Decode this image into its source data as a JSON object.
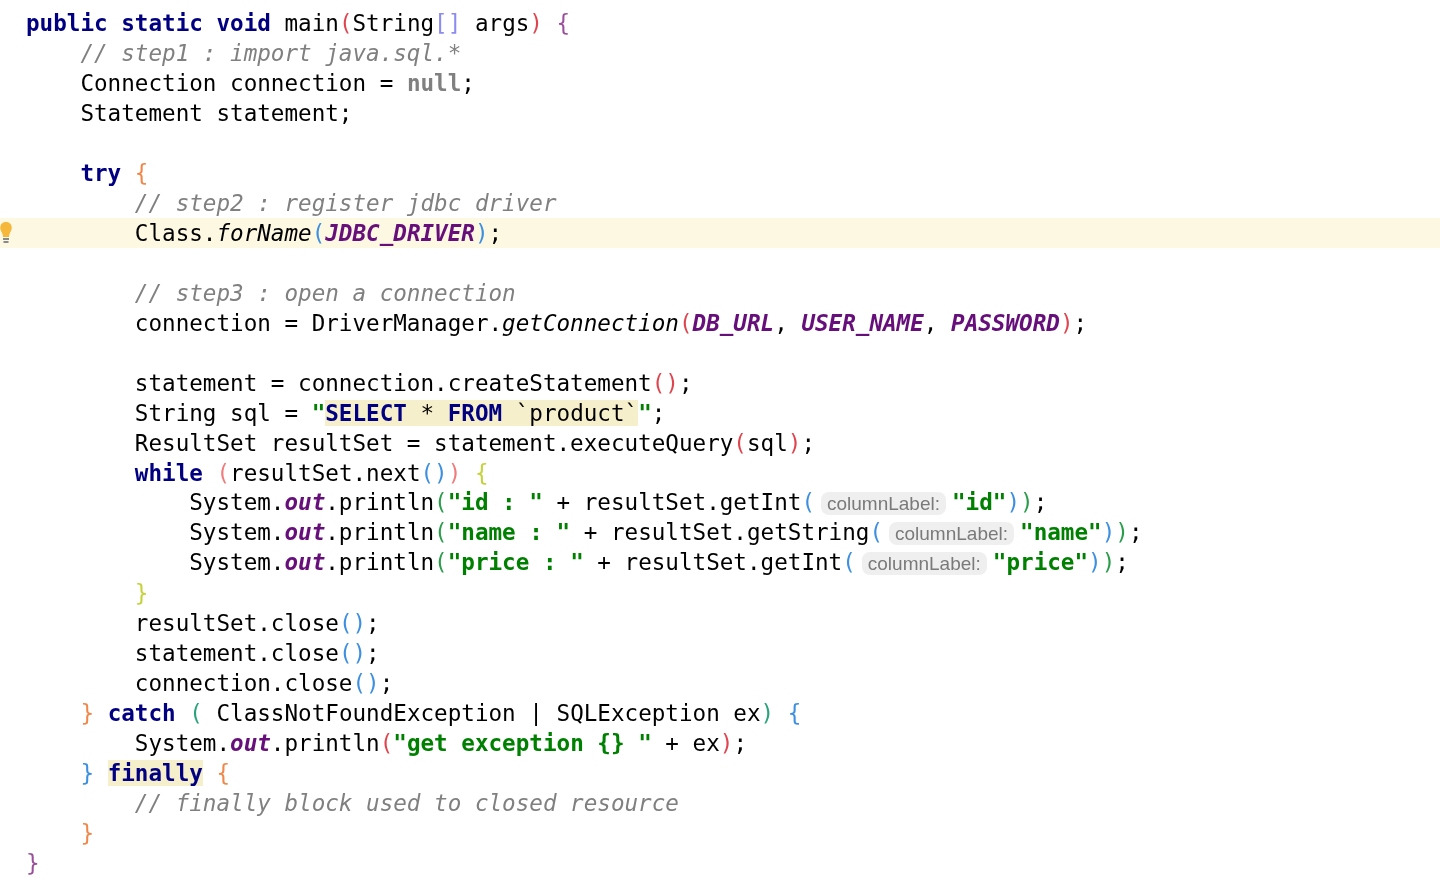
{
  "lines": [
    {
      "kind": "code",
      "current": false,
      "tokens": [
        {
          "kind": "keyword",
          "text": "public static void"
        },
        {
          "kind": "plain",
          "text": " main"
        },
        {
          "kind": "bracket",
          "text": "(",
          "color": "#e0454f"
        },
        {
          "kind": "plain",
          "text": "String"
        },
        {
          "kind": "bracket",
          "text": "[]",
          "color": "#8b8bf0"
        },
        {
          "kind": "plain",
          "text": " args"
        },
        {
          "kind": "bracket",
          "text": ")",
          "color": "#e0454f"
        },
        {
          "kind": "bracket",
          "text": " {",
          "color": "#9a4f9a"
        }
      ]
    },
    {
      "kind": "code",
      "current": false,
      "tokens": [
        {
          "kind": "comment",
          "text": "    // step1 : import java.sql.*"
        }
      ]
    },
    {
      "kind": "code",
      "current": false,
      "tokens": [
        {
          "kind": "plain",
          "text": "    Connection connection = "
        },
        {
          "kind": "literal",
          "text": "null"
        },
        {
          "kind": "plain",
          "text": ";"
        }
      ]
    },
    {
      "kind": "code",
      "current": false,
      "tokens": [
        {
          "kind": "plain",
          "text": "    Statement statement;"
        }
      ]
    },
    {
      "kind": "blank",
      "current": false
    },
    {
      "kind": "code",
      "current": false,
      "tokens": [
        {
          "kind": "keyword",
          "text": "    try"
        },
        {
          "kind": "bracket",
          "text": " {",
          "color": "#f0884b"
        }
      ]
    },
    {
      "kind": "code",
      "current": false,
      "tokens": [
        {
          "kind": "comment",
          "text": "        // step2 : register jdbc driver"
        }
      ]
    },
    {
      "kind": "code",
      "current": true,
      "tokens": [
        {
          "kind": "plain",
          "text": "        Class."
        },
        {
          "kind": "static-method",
          "text": "forName"
        },
        {
          "kind": "bracket",
          "text": "(",
          "color": "#3d8fe0"
        },
        {
          "kind": "constant",
          "text": "JDBC_DRIVER"
        },
        {
          "kind": "bracket",
          "text": ")",
          "color": "#3d8fe0"
        },
        {
          "kind": "plain",
          "text": ";"
        }
      ]
    },
    {
      "kind": "blank",
      "current": false
    },
    {
      "kind": "code",
      "current": false,
      "tokens": [
        {
          "kind": "comment",
          "text": "        // step3 : open a connection"
        }
      ]
    },
    {
      "kind": "code",
      "current": false,
      "tokens": [
        {
          "kind": "plain",
          "text": "        connection = DriverManager."
        },
        {
          "kind": "static-method",
          "text": "getConnection"
        },
        {
          "kind": "bracket",
          "text": "(",
          "color": "#e0454f"
        },
        {
          "kind": "constant",
          "text": "DB_URL"
        },
        {
          "kind": "plain",
          "text": ", "
        },
        {
          "kind": "constant",
          "text": "USER_NAME"
        },
        {
          "kind": "plain",
          "text": ", "
        },
        {
          "kind": "constant",
          "text": "PASSWORD"
        },
        {
          "kind": "bracket",
          "text": ")",
          "color": "#e0454f"
        },
        {
          "kind": "plain",
          "text": ";"
        }
      ]
    },
    {
      "kind": "blank",
      "current": false
    },
    {
      "kind": "code",
      "current": false,
      "tokens": [
        {
          "kind": "plain",
          "text": "        statement = connection.createStatement"
        },
        {
          "kind": "bracket",
          "text": "()",
          "color": "#e0454f"
        },
        {
          "kind": "plain",
          "text": ";"
        }
      ]
    },
    {
      "kind": "code",
      "current": false,
      "tokens": [
        {
          "kind": "plain",
          "text": "        String sql = "
        },
        {
          "kind": "string",
          "text": "\""
        },
        {
          "kind": "sql-keyword",
          "text": "SELECT"
        },
        {
          "kind": "sql-text",
          "text": " * "
        },
        {
          "kind": "sql-keyword",
          "text": "FROM"
        },
        {
          "kind": "sql-text",
          "text": " `product`"
        },
        {
          "kind": "string",
          "text": "\""
        },
        {
          "kind": "plain",
          "text": ";"
        }
      ]
    },
    {
      "kind": "code",
      "current": false,
      "tokens": [
        {
          "kind": "plain",
          "text": "        ResultSet resultSet = statement.executeQuery"
        },
        {
          "kind": "bracket",
          "text": "(",
          "color": "#e0454f"
        },
        {
          "kind": "plain",
          "text": "sql"
        },
        {
          "kind": "bracket",
          "text": ")",
          "color": "#e0454f"
        },
        {
          "kind": "plain",
          "text": ";"
        }
      ]
    },
    {
      "kind": "code",
      "current": false,
      "tokens": [
        {
          "kind": "keyword",
          "text": "        while"
        },
        {
          "kind": "bracket",
          "text": " (",
          "color": "#f07b7b"
        },
        {
          "kind": "plain",
          "text": "resultSet.next"
        },
        {
          "kind": "bracket",
          "text": "()",
          "color": "#3d8fe0"
        },
        {
          "kind": "bracket",
          "text": ")",
          "color": "#f07b7b"
        },
        {
          "kind": "bracket",
          "text": " {",
          "color": "#c5d23c"
        }
      ]
    },
    {
      "kind": "code",
      "current": false,
      "tokens": [
        {
          "kind": "plain",
          "text": "            System."
        },
        {
          "kind": "field",
          "text": "out"
        },
        {
          "kind": "plain",
          "text": ".println"
        },
        {
          "kind": "bracket",
          "text": "(",
          "color": "#2a9d4a"
        },
        {
          "kind": "string",
          "text": "\"id : \""
        },
        {
          "kind": "plain",
          "text": " + resultSet.getInt"
        },
        {
          "kind": "bracket",
          "text": "(",
          "color": "#3d8fe0"
        },
        {
          "kind": "hint",
          "text": "columnLabel:"
        },
        {
          "kind": "string",
          "text": "\"id\""
        },
        {
          "kind": "bracket",
          "text": ")",
          "color": "#3d8fe0"
        },
        {
          "kind": "bracket",
          "text": ")",
          "color": "#2a9d4a"
        },
        {
          "kind": "plain",
          "text": ";"
        }
      ]
    },
    {
      "kind": "code",
      "current": false,
      "tokens": [
        {
          "kind": "plain",
          "text": "            System."
        },
        {
          "kind": "field",
          "text": "out"
        },
        {
          "kind": "plain",
          "text": ".println"
        },
        {
          "kind": "bracket",
          "text": "(",
          "color": "#2a9d4a"
        },
        {
          "kind": "string",
          "text": "\"name : \""
        },
        {
          "kind": "plain",
          "text": " + resultSet.getString"
        },
        {
          "kind": "bracket",
          "text": "(",
          "color": "#3d8fe0"
        },
        {
          "kind": "hint",
          "text": "columnLabel:"
        },
        {
          "kind": "string",
          "text": "\"name\""
        },
        {
          "kind": "bracket",
          "text": ")",
          "color": "#3d8fe0"
        },
        {
          "kind": "bracket",
          "text": ")",
          "color": "#2a9d4a"
        },
        {
          "kind": "plain",
          "text": ";"
        }
      ]
    },
    {
      "kind": "code",
      "current": false,
      "tokens": [
        {
          "kind": "plain",
          "text": "            System."
        },
        {
          "kind": "field",
          "text": "out"
        },
        {
          "kind": "plain",
          "text": ".println"
        },
        {
          "kind": "bracket",
          "text": "(",
          "color": "#2a9d4a"
        },
        {
          "kind": "string",
          "text": "\"price : \""
        },
        {
          "kind": "plain",
          "text": " + resultSet.getInt"
        },
        {
          "kind": "bracket",
          "text": "(",
          "color": "#3d8fe0"
        },
        {
          "kind": "hint",
          "text": "columnLabel:"
        },
        {
          "kind": "string",
          "text": "\"price\""
        },
        {
          "kind": "bracket",
          "text": ")",
          "color": "#3d8fe0"
        },
        {
          "kind": "bracket",
          "text": ")",
          "color": "#2a9d4a"
        },
        {
          "kind": "plain",
          "text": ";"
        }
      ]
    },
    {
      "kind": "code",
      "current": false,
      "tokens": [
        {
          "kind": "bracket",
          "text": "        }",
          "color": "#c5d23c"
        }
      ]
    },
    {
      "kind": "code",
      "current": false,
      "tokens": [
        {
          "kind": "plain",
          "text": "        resultSet.close"
        },
        {
          "kind": "bracket",
          "text": "()",
          "color": "#3d8fe0"
        },
        {
          "kind": "plain",
          "text": ";"
        }
      ]
    },
    {
      "kind": "code",
      "current": false,
      "tokens": [
        {
          "kind": "plain",
          "text": "        statement.close"
        },
        {
          "kind": "bracket",
          "text": "()",
          "color": "#3d8fe0"
        },
        {
          "kind": "plain",
          "text": ";"
        }
      ]
    },
    {
      "kind": "code",
      "current": false,
      "tokens": [
        {
          "kind": "plain",
          "text": "        connection.close"
        },
        {
          "kind": "bracket",
          "text": "()",
          "color": "#3d8fe0"
        },
        {
          "kind": "plain",
          "text": ";"
        }
      ]
    },
    {
      "kind": "code",
      "current": false,
      "tokens": [
        {
          "kind": "bracket",
          "text": "    } ",
          "color": "#f0884b"
        },
        {
          "kind": "keyword",
          "text": "catch"
        },
        {
          "kind": "bracket",
          "text": " (",
          "color": "#29a37a"
        },
        {
          "kind": "plain",
          "text": " ClassNotFoundException | SQLException ex"
        },
        {
          "kind": "bracket",
          "text": ")",
          "color": "#29a37a"
        },
        {
          "kind": "bracket",
          "text": " {",
          "color": "#3d8fe0"
        }
      ]
    },
    {
      "kind": "code",
      "current": false,
      "tokens": [
        {
          "kind": "plain",
          "text": "        System."
        },
        {
          "kind": "field",
          "text": "out"
        },
        {
          "kind": "plain",
          "text": ".println"
        },
        {
          "kind": "bracket",
          "text": "(",
          "color": "#e0454f"
        },
        {
          "kind": "string",
          "text": "\"get exception {} \""
        },
        {
          "kind": "plain",
          "text": " + ex"
        },
        {
          "kind": "bracket",
          "text": ")",
          "color": "#e0454f"
        },
        {
          "kind": "plain",
          "text": ";"
        }
      ]
    },
    {
      "kind": "code",
      "current": false,
      "tokens": [
        {
          "kind": "bracket",
          "text": "    } ",
          "color": "#3d8fe0"
        },
        {
          "kind": "marked-keyword",
          "text": "finally"
        },
        {
          "kind": "bracket",
          "text": " {",
          "color": "#f0884b"
        }
      ]
    },
    {
      "kind": "code",
      "current": false,
      "tokens": [
        {
          "kind": "comment",
          "text": "        // finally block used to closed resource"
        }
      ]
    },
    {
      "kind": "code",
      "current": false,
      "tokens": [
        {
          "kind": "bracket",
          "text": "    }",
          "color": "#f0884b"
        }
      ]
    },
    {
      "kind": "code",
      "current": false,
      "tokens": [
        {
          "kind": "bracket",
          "text": "}",
          "color": "#9a4f9a"
        }
      ]
    }
  ]
}
